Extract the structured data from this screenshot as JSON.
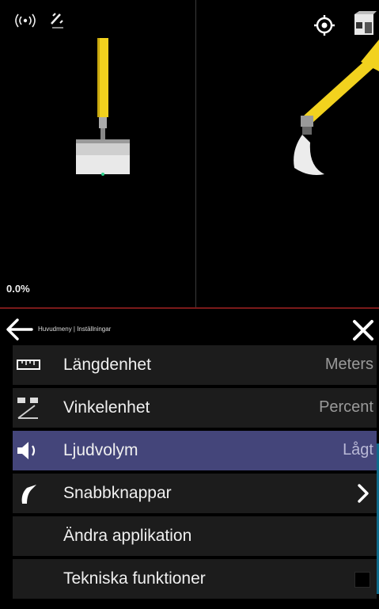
{
  "viewport": {
    "percent_readout": "0.0%",
    "status_icons": [
      "signal-icon",
      "satellite-icon"
    ],
    "top_right_icons": [
      "target-icon",
      "view-cube-icon"
    ]
  },
  "menu": {
    "breadcrumb": "Huvudmeny | Inställningar",
    "items": [
      {
        "label": "Längdenhet",
        "value": "Meters",
        "icon": "ruler-icon"
      },
      {
        "label": "Vinkelenhet",
        "value": "Percent",
        "icon": "angle-icon"
      },
      {
        "label": "Ljudvolym",
        "value": "Lågt",
        "icon": "speaker-icon",
        "selected": true
      },
      {
        "label": "Snabbknappar",
        "value": "",
        "icon": "quick-button-icon"
      },
      {
        "label": "Ändra applikation",
        "value": ""
      },
      {
        "label": "Tekniska funktioner",
        "value": "",
        "checked": false
      }
    ]
  },
  "colors": {
    "arm_yellow": "#f2d21e",
    "selected_row": "#44457a",
    "row_bg": "#1c1c1c"
  }
}
